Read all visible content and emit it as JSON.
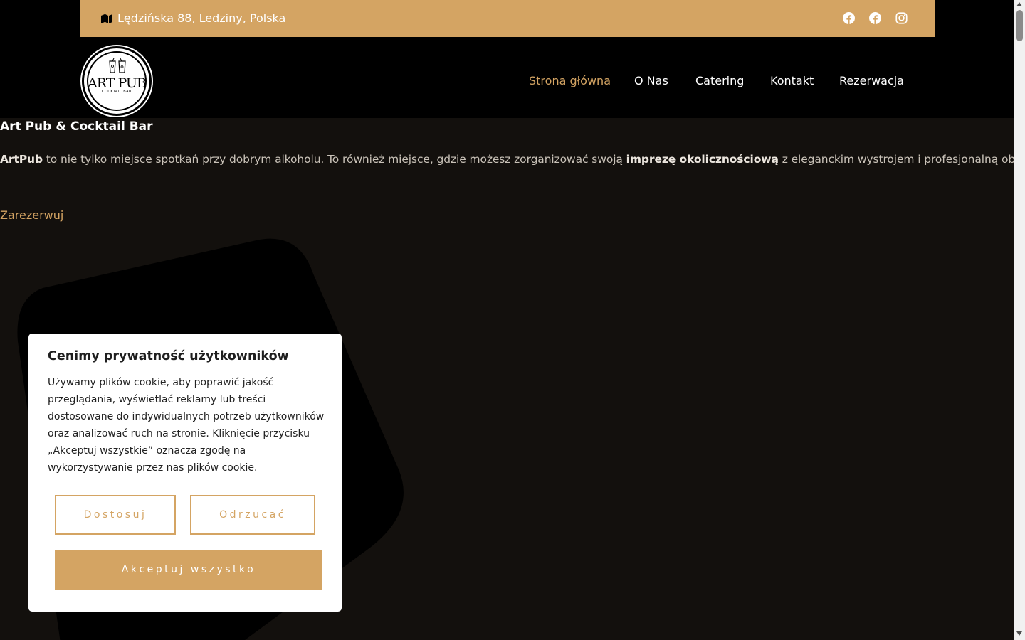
{
  "topbar": {
    "address": "Lędzińska 88, Ledziny, Polska",
    "address_icon": "map-icon",
    "social_icons": [
      "facebook-icon",
      "facebook-icon",
      "instagram-icon"
    ],
    "background": "#d4a463"
  },
  "logo": {
    "title": "ART PUB",
    "subtitle": "COCKTAIL BAR"
  },
  "nav": {
    "items": [
      {
        "label": "Strona główna",
        "active": true
      },
      {
        "label": "O Nas"
      },
      {
        "label": "Catering"
      },
      {
        "label": "Kontakt"
      },
      {
        "label": "Rezerwacja"
      }
    ]
  },
  "main": {
    "heading": "Art Pub & Cocktail Bar",
    "intro": {
      "brand": "ArtPub",
      "text1": " to nie tylko miejsce spotkań przy dobrym alkoholu. To również miejsce, gdzie możesz zorganizować swoją ",
      "emphasis": "imprezę okolicznościową",
      "text2": " z eleganckim wystrojem i profesjonalną obsługą."
    },
    "reserve_link": "Zarezerwuj"
  },
  "cookie": {
    "title": "Cenimy prywatność użytkowników",
    "text": "Używamy plików cookie, aby poprawić jakość przeglądania, wyświetlać reklamy lub treści dostosowane do indywidualnych potrzeb użytkowników oraz analizować ruch na stronie. Kliknięcie przycisku „Akceptuj wszystkie” oznacza zgodę na wykorzystywanie przez nas plików cookie.",
    "customize_label": "Dostosuj",
    "reject_label": "Odrzucać",
    "accept_label": "Akceptuj wszystko"
  },
  "colors": {
    "accent": "#d4a463",
    "page_background": "#13100d",
    "header_background": "#000000"
  }
}
